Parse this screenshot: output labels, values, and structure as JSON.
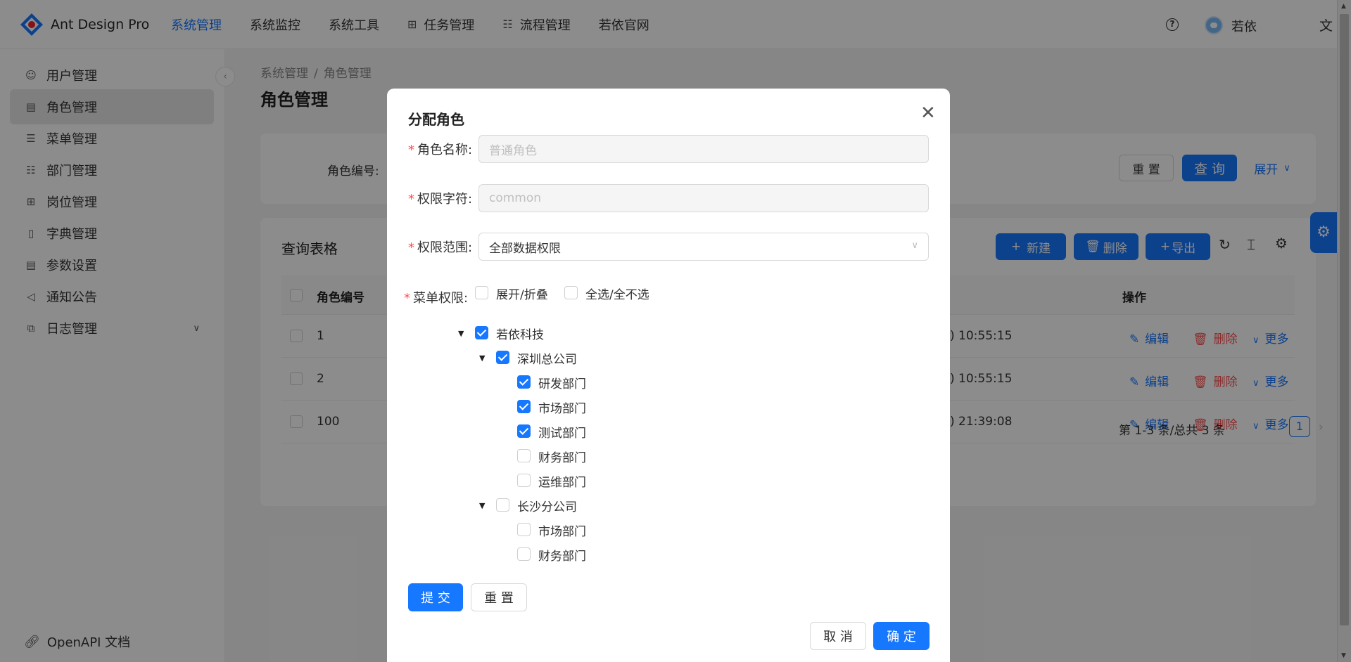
{
  "app": {
    "name": "Ant Design Pro"
  },
  "topnav": [
    {
      "label": "系统管理",
      "active": true,
      "icon": ""
    },
    {
      "label": "系统监控",
      "active": false,
      "icon": ""
    },
    {
      "label": "系统工具",
      "active": false,
      "icon": ""
    },
    {
      "label": "任务管理",
      "active": false,
      "icon": "appstore-icon"
    },
    {
      "label": "流程管理",
      "active": false,
      "icon": "cluster-icon"
    },
    {
      "label": "若依官网",
      "active": false,
      "icon": ""
    }
  ],
  "header": {
    "username": "若依",
    "help_icon": "question-circle-icon",
    "lang_icon": "translate-icon"
  },
  "sidebar": {
    "items": [
      {
        "label": "用户管理",
        "icon": "user-icon"
      },
      {
        "label": "角色管理",
        "icon": "role-icon",
        "active": true
      },
      {
        "label": "菜单管理",
        "icon": "menu-icon"
      },
      {
        "label": "部门管理",
        "icon": "apartment-icon"
      },
      {
        "label": "岗位管理",
        "icon": "post-icon"
      },
      {
        "label": "字典管理",
        "icon": "book-icon"
      },
      {
        "label": "参数设置",
        "icon": "setting-list-icon"
      },
      {
        "label": "通知公告",
        "icon": "notification-icon"
      },
      {
        "label": "日志管理",
        "icon": "log-icon",
        "expandable": true
      }
    ],
    "bottom": {
      "label": "OpenAPI 文档",
      "icon": "link-icon"
    }
  },
  "breadcrumb": {
    "root": "系统管理",
    "separator": "/",
    "current": "角色管理"
  },
  "page": {
    "title": "角色管理"
  },
  "search": {
    "role_id_label": "角色编号:",
    "reset": "重 置",
    "query": "查 询",
    "expand": "展开"
  },
  "table": {
    "title": "查询表格",
    "toolbar": {
      "new": "新建",
      "delete": "删除",
      "export": "导出"
    },
    "headers": {
      "role_id": "角色编号",
      "actions": "操作"
    },
    "rows": [
      {
        "id": "1",
        "time": ") 10:55:15"
      },
      {
        "id": "2",
        "time": ") 10:55:15"
      },
      {
        "id": "100",
        "time": ") 21:39:08"
      }
    ],
    "row_actions": {
      "edit": "编辑",
      "delete": "删除",
      "more": "更多"
    },
    "pagination": {
      "summary": "第 1-3 条/总共 3 条",
      "current": "1"
    }
  },
  "modal": {
    "title": "分配角色",
    "fields": {
      "role_name": {
        "label": "角色名称:",
        "placeholder": "普通角色"
      },
      "role_key": {
        "label": "权限字符:",
        "placeholder": "common"
      },
      "data_scope": {
        "label": "权限范围:",
        "value": "全部数据权限"
      },
      "menu_perm": {
        "label": "菜单权限:",
        "expand_collapse": "展开/折叠",
        "select_all": "全选/全不选"
      }
    },
    "tree": [
      {
        "label": "若依科技",
        "level": 0,
        "checked": true,
        "caret": true
      },
      {
        "label": "深圳总公司",
        "level": 1,
        "checked": true,
        "caret": true
      },
      {
        "label": "研发部门",
        "level": 2,
        "checked": true
      },
      {
        "label": "市场部门",
        "level": 2,
        "checked": true
      },
      {
        "label": "测试部门",
        "level": 2,
        "checked": true
      },
      {
        "label": "财务部门",
        "level": 2,
        "checked": false
      },
      {
        "label": "运维部门",
        "level": 2,
        "checked": false
      },
      {
        "label": "长沙分公司",
        "level": 1,
        "checked": false,
        "caret": true
      },
      {
        "label": "市场部门",
        "level": 2,
        "checked": false
      },
      {
        "label": "财务部门",
        "level": 2,
        "checked": false
      }
    ],
    "submit": "提 交",
    "reset": "重 置",
    "cancel": "取 消",
    "ok": "确 定"
  },
  "colors": {
    "primary": "#1677ff",
    "danger": "#ff4d4f"
  }
}
